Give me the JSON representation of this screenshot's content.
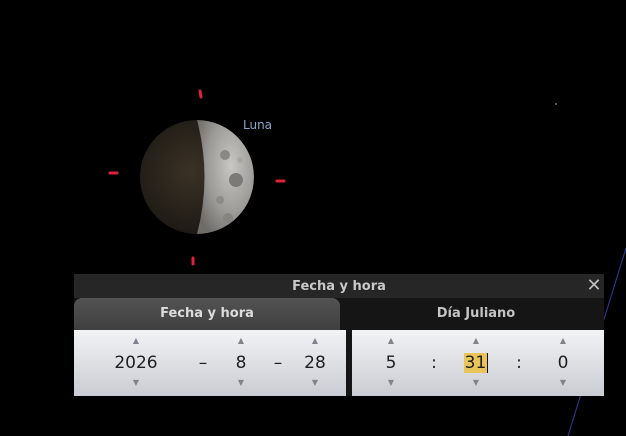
{
  "sky": {
    "object_label": "Luna"
  },
  "dialog": {
    "title": "Fecha y hora",
    "close_icon": "close-icon",
    "tabs": [
      {
        "label": "Fecha y hora",
        "active": true
      },
      {
        "label": "Día Juliano",
        "active": false
      }
    ],
    "date": {
      "year": "2026",
      "month": "8",
      "day": "28",
      "separator": "–"
    },
    "time": {
      "hour": "5",
      "minute": "31",
      "second": "0",
      "separator": ":"
    }
  },
  "colors": {
    "marker": "#e0213a",
    "label": "#8fa3c8",
    "highlight": "#e9c45a"
  }
}
